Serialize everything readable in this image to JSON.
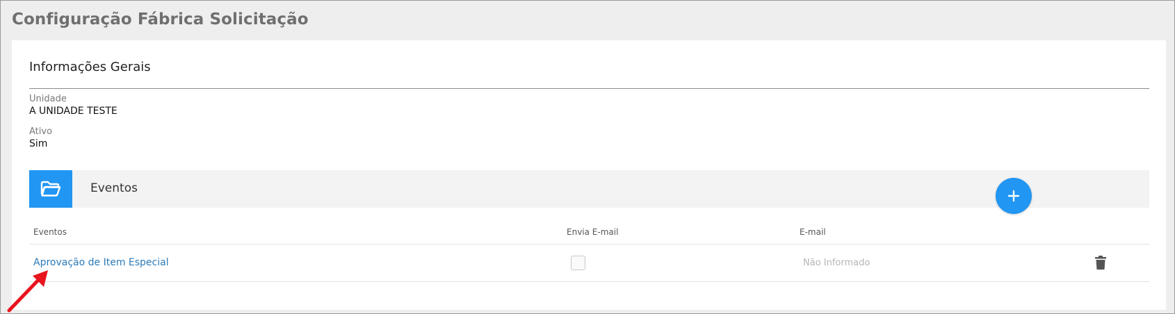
{
  "page": {
    "title": "Configuração Fábrica Solicitação"
  },
  "general": {
    "title": "Informações Gerais",
    "fields": [
      {
        "label": "Unidade",
        "value": "A UNIDADE TESTE"
      },
      {
        "label": "Ativo",
        "value": "Sim"
      }
    ]
  },
  "events": {
    "title": "Eventos",
    "columns": {
      "event": "Eventos",
      "send_email": "Envia E-mail",
      "email": "E-mail"
    },
    "rows": [
      {
        "event": "Aprovação de Item Especial",
        "send_email": false,
        "email": "Não Informado"
      }
    ]
  },
  "icons": {
    "section": "folder-open-icon",
    "add": "plus-icon",
    "delete": "trash-icon",
    "annotation": "red-arrow-icon"
  },
  "colors": {
    "accent": "#2196f3",
    "link": "#2a7ab8",
    "annotation": "#e8141e",
    "title": "#6f6f6f"
  }
}
